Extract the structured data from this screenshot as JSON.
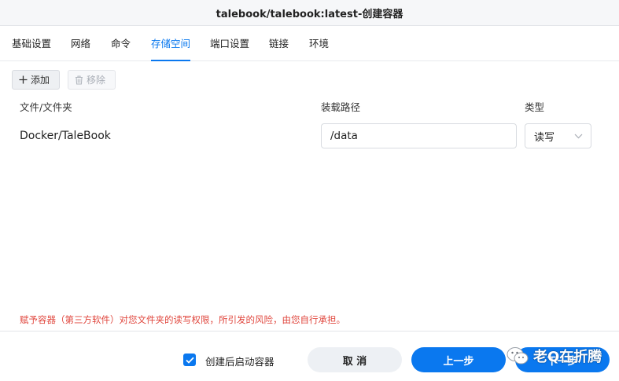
{
  "window": {
    "title": "talebook/talebook:latest-创建容器"
  },
  "tabs": [
    {
      "label": "基础设置",
      "active": false
    },
    {
      "label": "网络",
      "active": false
    },
    {
      "label": "命令",
      "active": false
    },
    {
      "label": "存储空间",
      "active": true
    },
    {
      "label": "端口设置",
      "active": false
    },
    {
      "label": "链接",
      "active": false
    },
    {
      "label": "环境",
      "active": false
    }
  ],
  "toolbar": {
    "add_label": "添加",
    "remove_label": "移除",
    "remove_disabled": true
  },
  "table": {
    "columns": [
      "文件/文件夹",
      "装载路径",
      "类型"
    ],
    "rows": [
      {
        "folder": "Docker/TaleBook",
        "mount_path": "/data",
        "type": "读写"
      }
    ]
  },
  "warning": "赋予容器（第三方软件）对您文件夹的读写权限，所引发的风险，由您自行承担。",
  "footer": {
    "start_after_create_label": "创建后启动容器",
    "start_after_create_checked": true,
    "cancel_label": "取 消",
    "prev_label": "上一步",
    "next_label": "下一步"
  },
  "watermark": {
    "text": "老Q在折腾",
    "icon": "wechat-icon"
  },
  "colors": {
    "accent": "#0a78ef",
    "warning": "#e0463d"
  }
}
